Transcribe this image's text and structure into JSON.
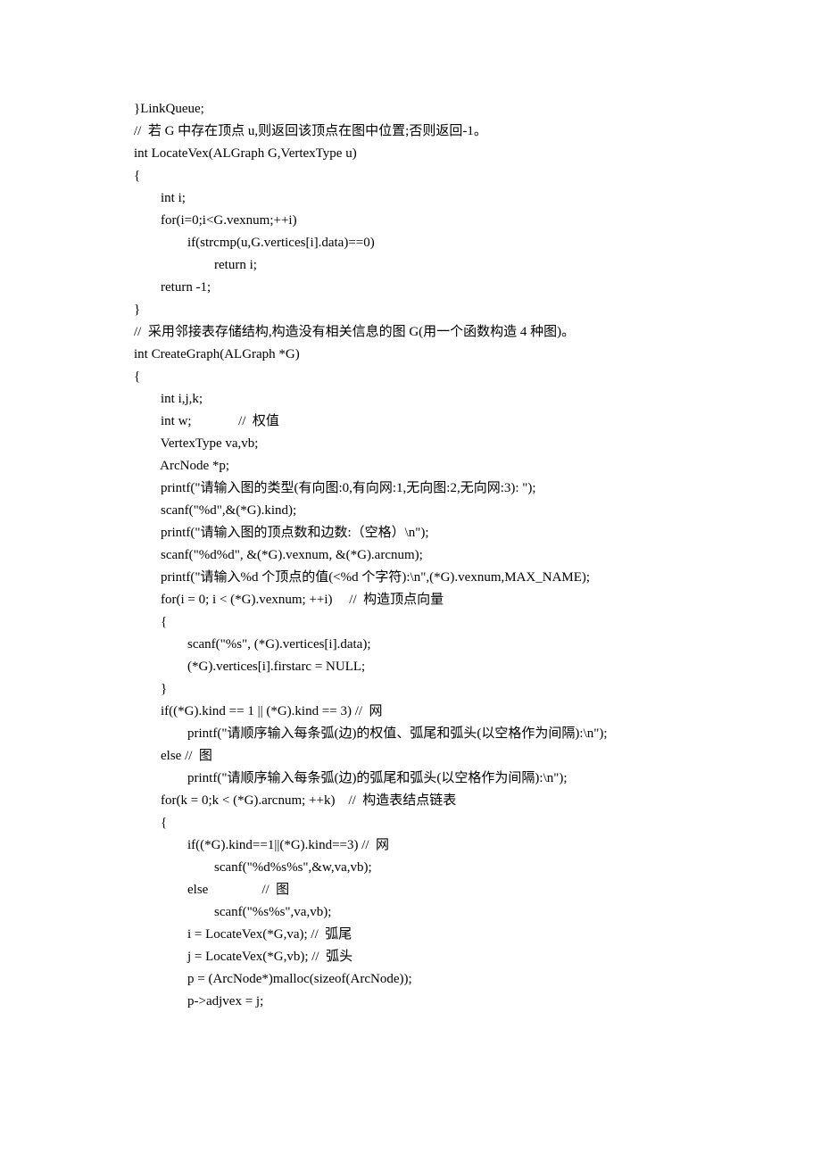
{
  "lines": [
    "}LinkQueue;",
    "",
    "//  若 G 中存在顶点 u,则返回该顶点在图中位置;否则返回-1。",
    "int LocateVex(ALGraph G,VertexType u)",
    "{",
    "        int i;",
    "        for(i=0;i<G.vexnum;++i)",
    "                if(strcmp(u,G.vertices[i].data)==0)",
    "                        return i;",
    "        return -1;",
    "}",
    "",
    "//  采用邻接表存储结构,构造没有相关信息的图 G(用一个函数构造 4 种图)。",
    "int CreateGraph(ALGraph *G)",
    "{",
    "        int i,j,k;",
    "        int w;              //  权值",
    "        VertexType va,vb;",
    "        ArcNode *p;",
    "",
    "        printf(\"请输入图的类型(有向图:0,有向网:1,无向图:2,无向网:3): \");",
    "        scanf(\"%d\",&(*G).kind);",
    "        printf(\"请输入图的顶点数和边数:（空格）\\n\");",
    "        scanf(\"%d%d\", &(*G).vexnum, &(*G).arcnum);",
    "        printf(\"请输入%d 个顶点的值(<%d 个字符):\\n\",(*G).vexnum,MAX_NAME);",
    "        for(i = 0; i < (*G).vexnum; ++i)     //  构造顶点向量",
    "        {",
    "                scanf(\"%s\", (*G).vertices[i].data);",
    "                (*G).vertices[i].firstarc = NULL;",
    "        }",
    "        if((*G).kind == 1 || (*G).kind == 3) //  网",
    "                printf(\"请顺序输入每条弧(边)的权值、弧尾和弧头(以空格作为间隔):\\n\");",
    "        else //  图",
    "                printf(\"请顺序输入每条弧(边)的弧尾和弧头(以空格作为间隔):\\n\");",
    "        for(k = 0;k < (*G).arcnum; ++k)    //  构造表结点链表",
    "        {",
    "                if((*G).kind==1||(*G).kind==3) //  网",
    "                        scanf(\"%d%s%s\",&w,va,vb);",
    "                else                //  图",
    "                        scanf(\"%s%s\",va,vb);",
    "                i = LocateVex(*G,va); //  弧尾",
    "                j = LocateVex(*G,vb); //  弧头",
    "                p = (ArcNode*)malloc(sizeof(ArcNode));",
    "                p->adjvex = j;"
  ]
}
